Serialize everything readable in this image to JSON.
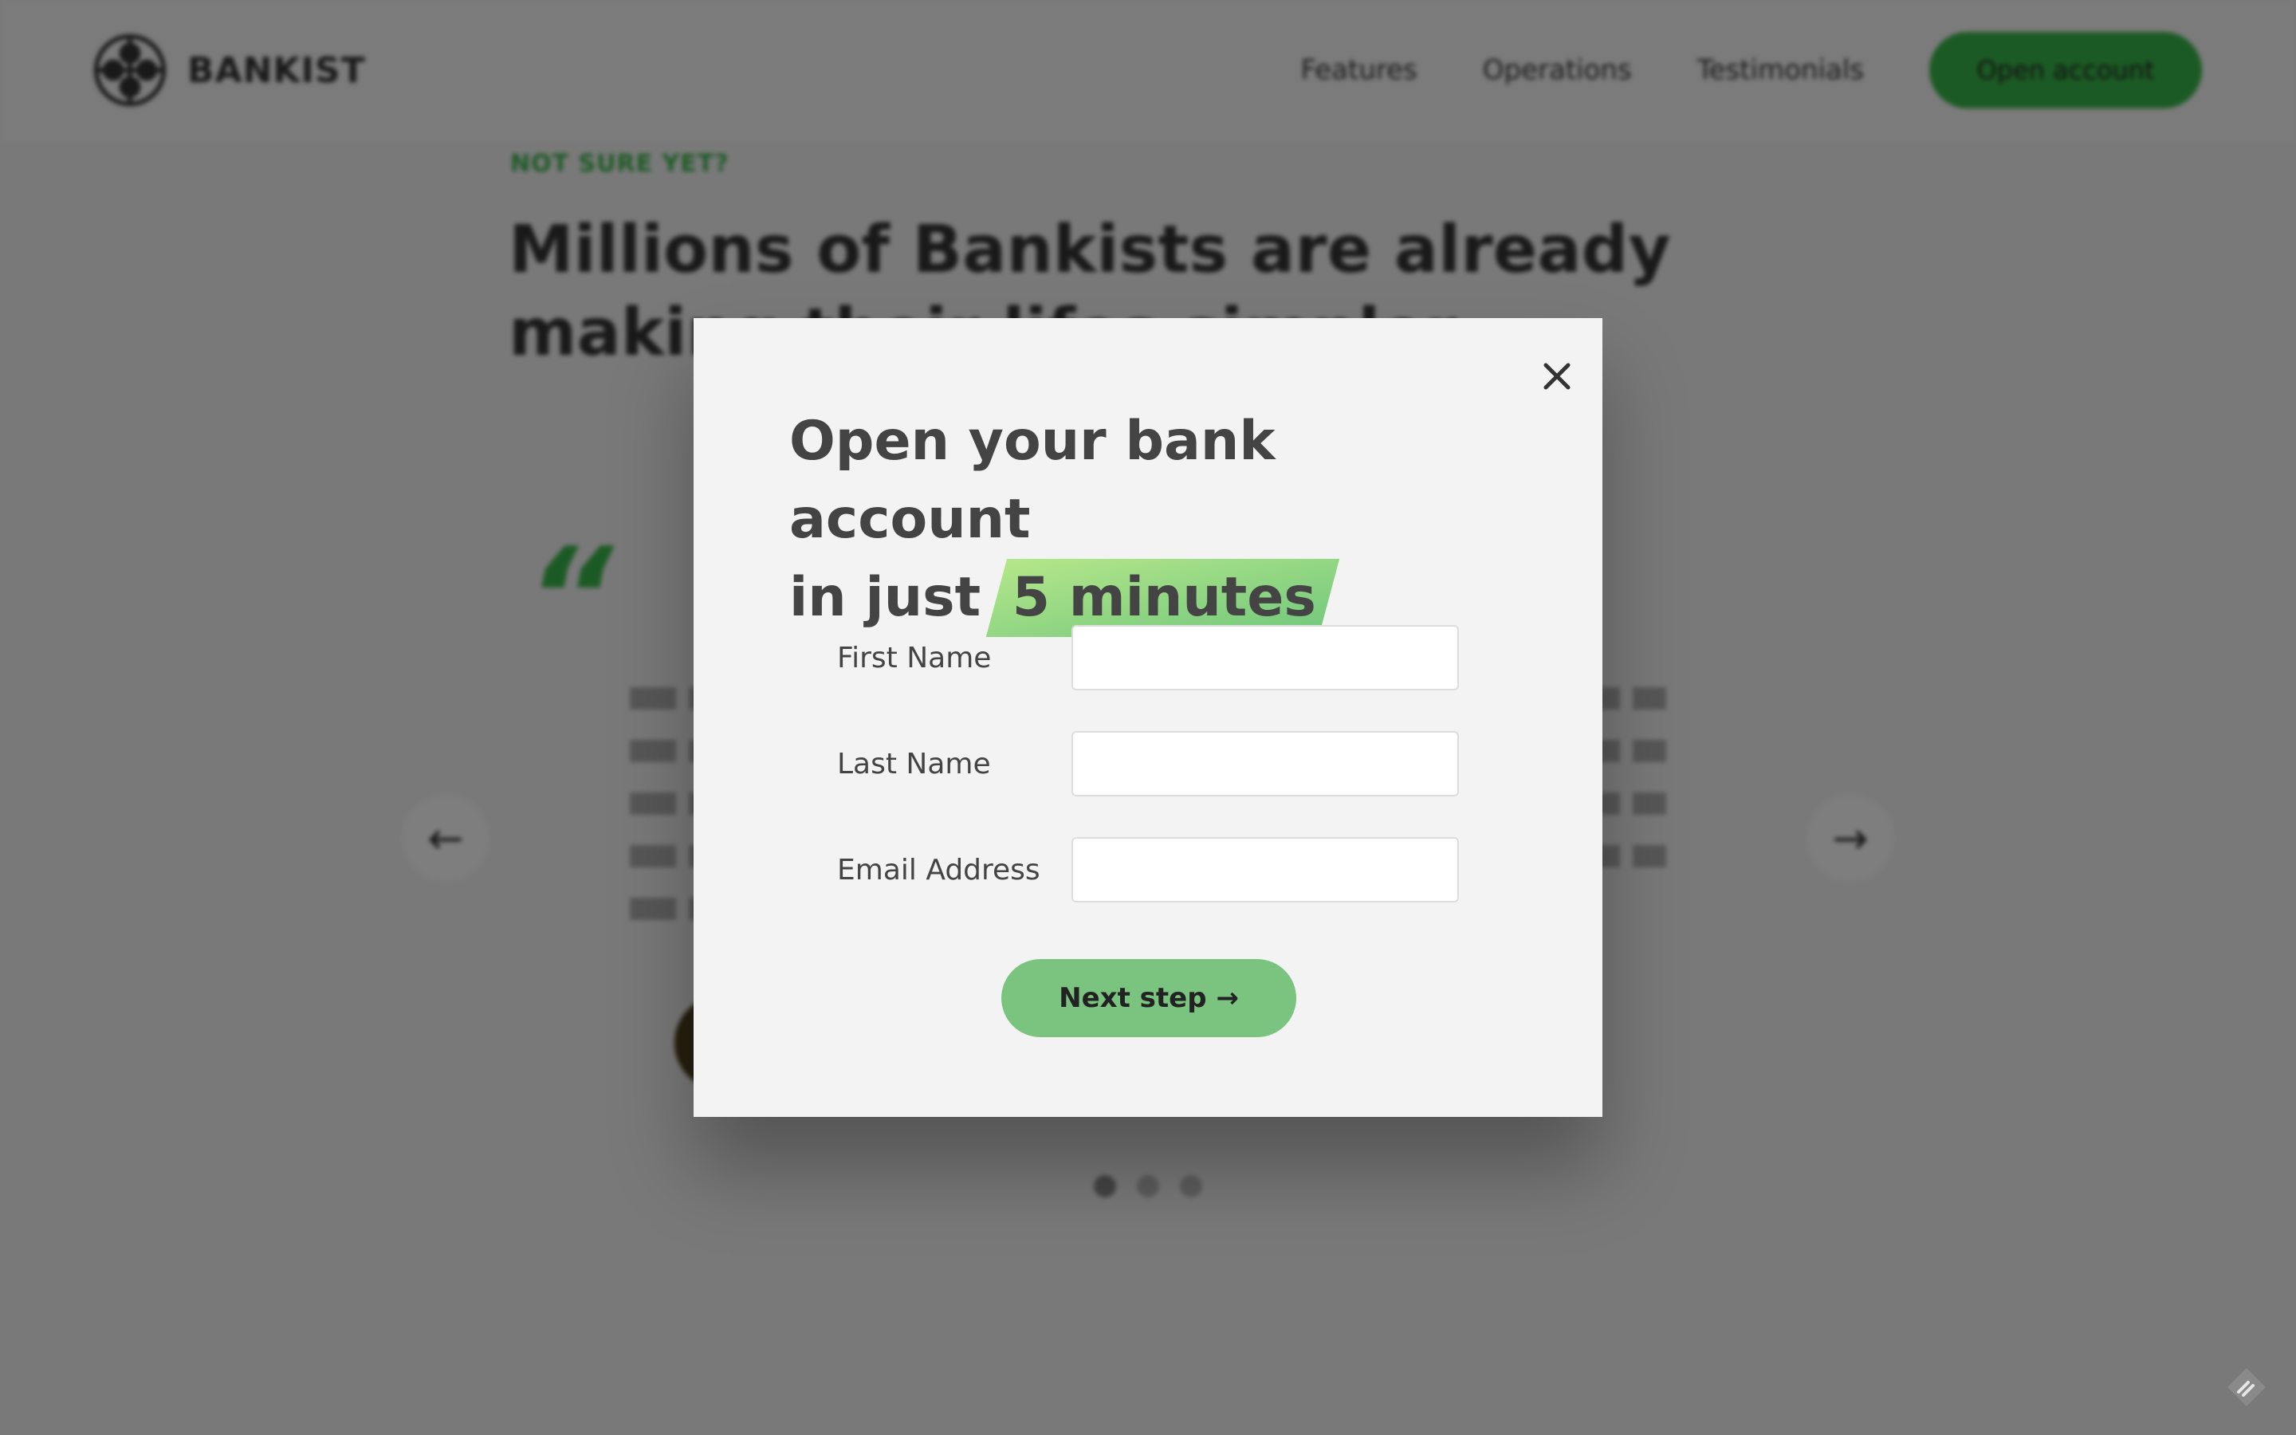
{
  "background": {
    "logo_text": "BANKIST",
    "nav": {
      "links": [
        "Features",
        "Operations",
        "Testimonials"
      ],
      "cta_label": "Open account"
    },
    "section": {
      "kicker": "NOT SURE YET?",
      "heading": "Millions of Bankists are already making their lifes simpler."
    },
    "testimonial": {
      "quote_glyph": "“",
      "prev_arrow": "←",
      "next_arrow": "→"
    }
  },
  "modal": {
    "close_glyph": "×",
    "title_line1": "Open your bank account",
    "title_line2_prefix": "in just",
    "title_highlight": "5 minutes",
    "fields": [
      {
        "label": "First Name",
        "value": "",
        "placeholder": ""
      },
      {
        "label": "Last Name",
        "value": "",
        "placeholder": ""
      },
      {
        "label": "Email Address",
        "value": "",
        "placeholder": ""
      }
    ],
    "next_button_label": "Next step →"
  },
  "colors": {
    "brand_green": "#39b54a",
    "button_green": "#7ac47f",
    "overlay": "rgba(0,0,0,0.5)",
    "modal_bg": "#f3f3f3"
  },
  "icons": {
    "logo": "bankist-logo-icon",
    "close": "close-icon",
    "arrow_left": "arrow-left-icon",
    "arrow_right": "arrow-right-icon",
    "corner": "app-corner-icon"
  }
}
